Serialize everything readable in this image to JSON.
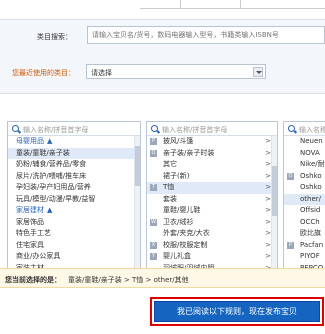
{
  "search": {
    "label": "类目搜索：",
    "placeholder": "请输入宝贝名/货号，数码电器输入型号，书籍类输入ISBN号"
  },
  "recent": {
    "label": "您最近使用的类目：",
    "selected": "请选择"
  },
  "columns": [
    {
      "placeholder": "输入名称/拼音首字母",
      "items": [
        {
          "label": "母婴用品",
          "type": "group",
          "arrow": "▲"
        },
        {
          "label": "童装/童鞋/亲子装",
          "type": "item",
          "selected": true
        },
        {
          "label": "奶粉/辅食/营养品/零食",
          "type": "item"
        },
        {
          "label": "尿片/洗护/喂哺/推车床",
          "type": "item"
        },
        {
          "label": "孕妇装/孕产妇用品/营养",
          "type": "item"
        },
        {
          "label": "玩具/模型/动漫/早教/益智",
          "type": "item"
        },
        {
          "label": "家居建材",
          "type": "group",
          "arrow": "▲"
        },
        {
          "label": "家居饰品",
          "type": "item"
        },
        {
          "label": "特色手工艺",
          "type": "item"
        },
        {
          "label": "住宅家具",
          "type": "item"
        },
        {
          "label": "商业/办公家具",
          "type": "item"
        },
        {
          "label": "家装主材",
          "type": "item"
        }
      ]
    },
    {
      "placeholder": "输入名称/拼音首字母",
      "items": [
        {
          "letter": "P",
          "label": "披风/斗篷",
          "chevron": ">"
        },
        {
          "letter": "Q",
          "label": "亲子装/亲子时装",
          "chevron": ">"
        },
        {
          "letter": "",
          "label": "其它",
          "chevron": ">"
        },
        {
          "letter": "",
          "label": "裙子(新)",
          "chevron": ">"
        },
        {
          "letter": "T",
          "label": "T恤",
          "chevron": ">",
          "selected": true
        },
        {
          "letter": "",
          "label": "套装",
          "chevron": ">"
        },
        {
          "letter": "",
          "label": "童鞋/婴儿鞋",
          "chevron": ">"
        },
        {
          "letter": "W",
          "label": "卫衣/绒衫",
          "chevron": ">"
        },
        {
          "letter": "",
          "label": "外套/夹克/大衣",
          "chevron": ">"
        },
        {
          "letter": "X",
          "label": "校服/校服定制",
          "chevron": ">"
        },
        {
          "letter": "Y",
          "label": "婴儿礼盒",
          "chevron": ">"
        },
        {
          "letter": "",
          "label": "羽绒服/羽绒内胆",
          "chevron": ">"
        }
      ]
    },
    {
      "placeholder": "输入名称",
      "items": [
        {
          "letter": "",
          "label": "Neuen"
        },
        {
          "letter": "",
          "label": "NOVA"
        },
        {
          "letter": "",
          "label": "Nike/耐"
        },
        {
          "letter": "O",
          "label": "Oshko"
        },
        {
          "letter": "",
          "label": "Oshko"
        },
        {
          "letter": "",
          "label": "other/",
          "selected": true
        },
        {
          "letter": "",
          "label": "Offsid"
        },
        {
          "letter": "",
          "label": "OCCh"
        },
        {
          "letter": "",
          "label": "欧比旗"
        },
        {
          "letter": "P",
          "label": "Pacfan"
        },
        {
          "letter": "",
          "label": "PIYOF"
        },
        {
          "letter": "",
          "label": "PEPCO"
        }
      ]
    }
  ],
  "chosen": {
    "label": "您当前选择的是：",
    "path": "童装/童鞋/亲子装 > T恤 > other/其他"
  },
  "submit_label": "我已阅读以下规则，现在发布宝贝",
  "colors": {
    "accent": "#1565c0",
    "highlight_border": "#e00000",
    "recent_label": "#d45500",
    "group": "#2a63b8"
  }
}
